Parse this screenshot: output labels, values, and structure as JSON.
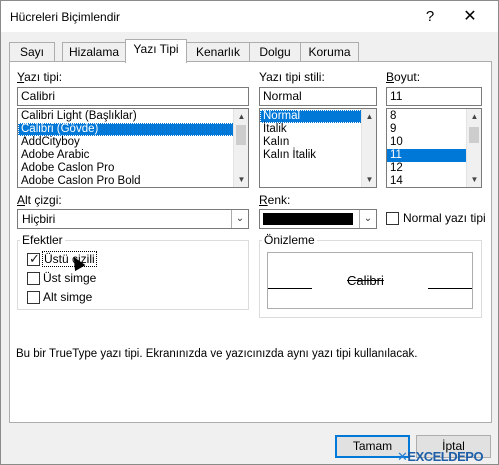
{
  "window": {
    "title": "Hücreleri Biçimlendir",
    "help": "?",
    "close": "✕"
  },
  "tabs": [
    "Sayı",
    "Hizalama",
    "Yazı Tipi",
    "Kenarlık",
    "Dolgu",
    "Koruma"
  ],
  "active_tab": "Yazı Tipi",
  "font": {
    "label_prefix": "Y",
    "label_rest": "azı tipi:",
    "value": "Calibri",
    "list": [
      "Calibri Light (Başlıklar)",
      "Calibri (Gövde)",
      "AddCityboy",
      "Adobe Arabic",
      "Adobe Caslon Pro",
      "Adobe Caslon Pro Bold"
    ]
  },
  "style": {
    "label": "Yazı tipi stili:",
    "value": "Normal",
    "list": [
      "Normal",
      "İtalik",
      "Kalın",
      "Kalın İtalik"
    ]
  },
  "size": {
    "label_prefix": "B",
    "label_rest": "oyut:",
    "value": "11",
    "list": [
      "8",
      "9",
      "10",
      "11",
      "12",
      "14"
    ]
  },
  "underline": {
    "label_prefix": "A",
    "label_rest": "lt çizgi:",
    "value": "Hiçbiri"
  },
  "color": {
    "label_prefix": "R",
    "label_rest": "enk:",
    "swatch": "#000000"
  },
  "normal_font": {
    "label": "Normal yazı tipi",
    "checked": false
  },
  "effects": {
    "title": "Efektler",
    "strikethrough": {
      "label": "Üstü çizili",
      "checked": true
    },
    "superscript": {
      "label": "Üst simge",
      "checked": false
    },
    "subscript": {
      "label": "Alt simge",
      "checked": false
    }
  },
  "preview": {
    "title": "Önizleme",
    "text": "Calibri"
  },
  "info_text": "Bu bir TrueType yazı tipi. Ekranınızda ve yazıcınızda aynı yazı tipi kullanılacak.",
  "buttons": {
    "ok": "Tamam",
    "cancel": "İptal"
  },
  "watermark": {
    "x": "✕",
    "text": "EXCELDEPO"
  },
  "colors": {
    "selection": "#0078d7",
    "dialog_bg": "#f0f0f0"
  }
}
